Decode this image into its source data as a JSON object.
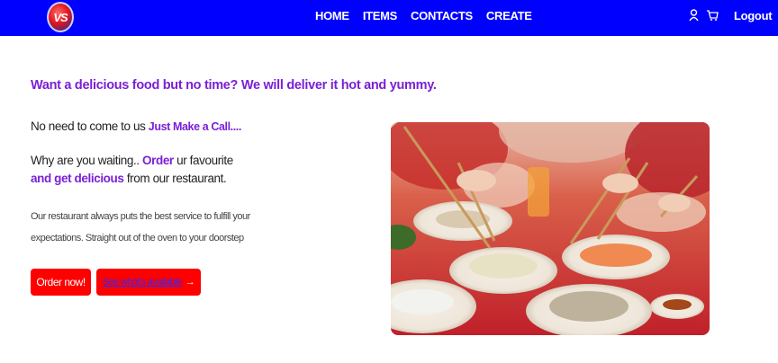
{
  "brand": {
    "logo_text": "VS"
  },
  "nav": {
    "items": [
      "HOME",
      "ITEMS",
      "CONTACTS",
      "CREATE"
    ],
    "user_icon": "user-icon",
    "cart_icon": "cart-icon",
    "logout_label": "Logout"
  },
  "hero": {
    "headline": "Want a delicious food but no time? We will deliver it hot and yummy.",
    "line1_plain": "No need to come to us ",
    "line1_accent": "Just Make a Call....",
    "line2_plain": "Why are you waiting..  ",
    "line2_accent": "Order",
    "line2_rest": " ur favourite",
    "line3_accent": "and get delicious",
    "line3_rest": " from our restaurant.",
    "description": "Our restaurant always puts the best service to fulfill your expectations. Straight out of the oven to your doorstep",
    "primary_button": "Order now!",
    "secondary_button": "See what's available",
    "secondary_icon": "arrow-right-icon"
  },
  "colors": {
    "navbar": "#0000ff",
    "accent": "#7a1fd6",
    "button": "#ff0000"
  }
}
